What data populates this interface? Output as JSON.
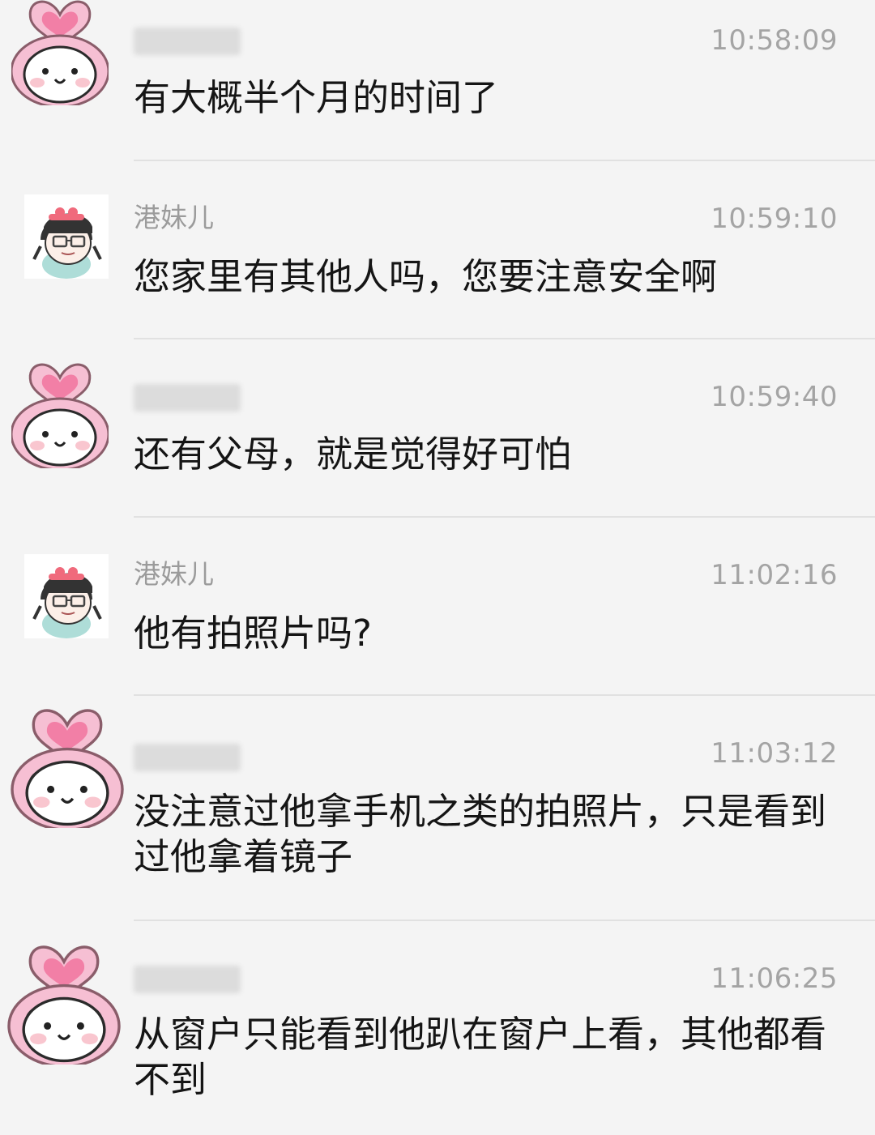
{
  "messages": [
    {
      "sender": "",
      "time": "10:58:09",
      "text": "有大概半个月的时间了",
      "avatar_icon": "pink-heart-girl-avatar"
    },
    {
      "sender": "港妹儿",
      "time": "10:59:10",
      "text": "您家里有其他人吗，您要注意安全啊",
      "avatar_icon": "glasses-girl-avatar"
    },
    {
      "sender": "",
      "time": "10:59:40",
      "text": "还有父母，就是觉得好可怕",
      "avatar_icon": "pink-heart-girl-avatar"
    },
    {
      "sender": "港妹儿",
      "time": "11:02:16",
      "text": "他有拍照片吗?",
      "avatar_icon": "glasses-girl-avatar"
    },
    {
      "sender": "",
      "time": "11:03:12",
      "text": "没注意过他拿手机之类的拍照片，只是看到过他拿着镜子",
      "avatar_icon": "pink-heart-girl-avatar"
    },
    {
      "sender": "",
      "time": "11:06:25",
      "text": "从窗户只能看到他趴在窗户上看，其他都看不到",
      "avatar_icon": "pink-heart-girl-avatar"
    }
  ],
  "colors": {
    "background": "#f4f4f4",
    "sender": "#9b9b9b",
    "time": "#a4a4a4",
    "text": "#151515",
    "divider": "#e1e1e1",
    "avatar_pink": "#f6bfd3"
  }
}
